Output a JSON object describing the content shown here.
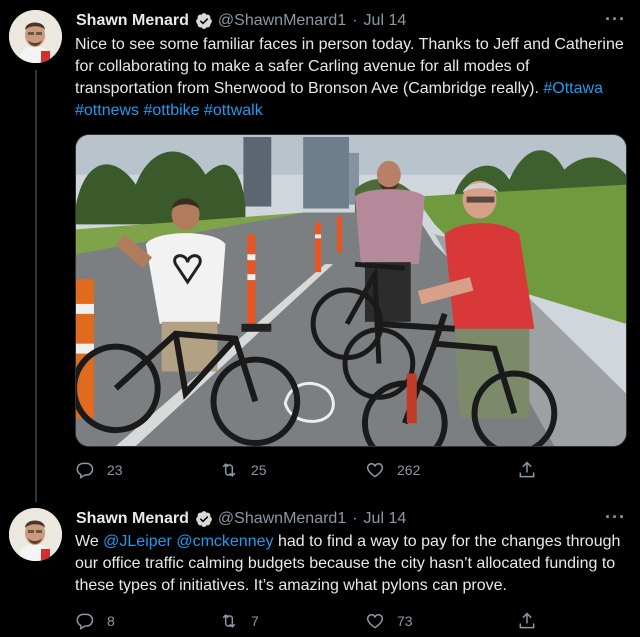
{
  "thread": [
    {
      "author": {
        "name": "Shawn Menard",
        "handle": "@ShawnMenard1"
      },
      "date": "Jul 14",
      "more_label": "···",
      "text_plain": "Nice to see some familiar faces in person today. Thanks to Jeff and Catherine for collaborating to make a safer Carling avenue for all modes of transportation from Sherwood to Bronson Ave (Cambridge really). ",
      "hashtags": [
        "#Ottawa",
        "#ottnews",
        "#ottbike",
        "#ottwalk"
      ],
      "has_photo": true,
      "stats": {
        "replies": "23",
        "retweets": "25",
        "likes": "262"
      }
    },
    {
      "author": {
        "name": "Shawn Menard",
        "handle": "@ShawnMenard1"
      },
      "date": "Jul 14",
      "more_label": "···",
      "text_prefix": "We ",
      "mentions": [
        "@JLeiper",
        "@cmckenney"
      ],
      "text_suffix": " had to find a way to pay for the changes through our office traffic calming budgets because the city hasn’t allocated funding to these types of initiatives. It’s amazing what pylons can prove.",
      "stats": {
        "replies": "8",
        "retweets": "7",
        "likes": "73"
      }
    }
  ],
  "colors": {
    "background": "#000000",
    "link": "#1d9bf0",
    "muted": "#8b98a5",
    "verified": "#d9d9d9"
  },
  "icons": [
    "reply-icon",
    "retweet-icon",
    "like-icon",
    "share-icon",
    "verified-badge-icon",
    "more-icon"
  ]
}
